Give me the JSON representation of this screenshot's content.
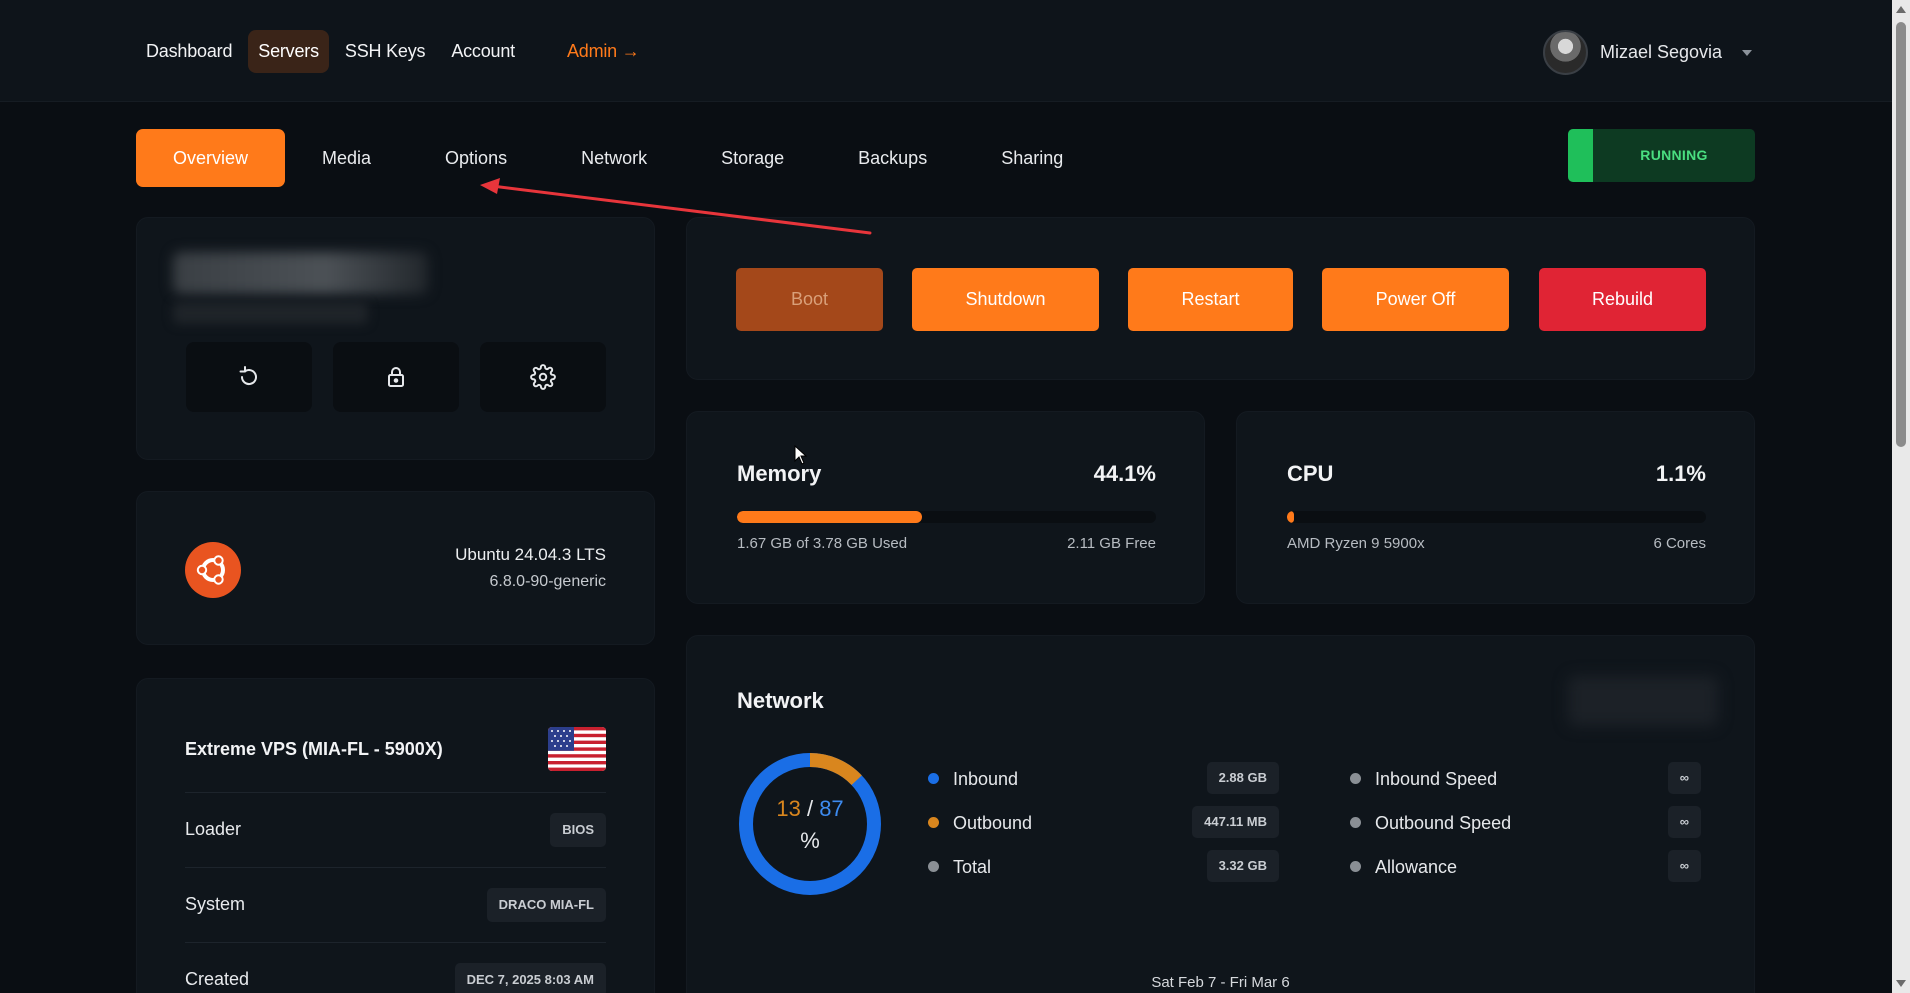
{
  "nav": {
    "dashboard": "Dashboard",
    "servers": "Servers",
    "ssh_keys": "SSH Keys",
    "account": "Account",
    "admin": "Admin →"
  },
  "user": {
    "name": "Mizael Segovia"
  },
  "tabs": [
    "Overview",
    "Media",
    "Options",
    "Network",
    "Storage",
    "Backups",
    "Sharing"
  ],
  "status": {
    "label": "RUNNING",
    "color": "#4ade80"
  },
  "quick_actions": [
    "reinstall-icon",
    "lock-icon",
    "gear-icon"
  ],
  "os": {
    "name": "Ubuntu 24.04.3 LTS",
    "kernel": "6.8.0-90-generic",
    "icon": "ubuntu-icon"
  },
  "plan": {
    "title": "Extreme VPS (MIA-FL - 5900X)",
    "flag_icon": "us-flag-icon",
    "specs": [
      {
        "key": "Loader",
        "value": "BIOS"
      },
      {
        "key": "System",
        "value": "DRACO MIA-FL"
      },
      {
        "key": "Created",
        "value": "DEC 7, 2025 8:03 AM"
      }
    ]
  },
  "power": {
    "boot": "Boot",
    "shutdown": "Shutdown",
    "restart": "Restart",
    "poweroff": "Power Off",
    "rebuild": "Rebuild"
  },
  "memory": {
    "title": "Memory",
    "percent": "44.1%",
    "fraction": 0.441,
    "used": "1.67 GB of 3.78 GB Used",
    "free": "2.11 GB Free"
  },
  "cpu": {
    "title": "CPU",
    "percent": "1.1%",
    "fraction": 0.011,
    "model": "AMD Ryzen 9 5900x",
    "cores": "6 Cores"
  },
  "network": {
    "title": "Network",
    "outbound_pct": "13",
    "separator": "/",
    "inbound_pct": "87",
    "pct_symbol": "%",
    "outbound_fraction": 0.13,
    "stats": [
      {
        "name": "Inbound",
        "value": "2.88 GB",
        "color": "#1a6ee6"
      },
      {
        "name": "Outbound",
        "value": "447.11 MB",
        "color": "#d9861e"
      },
      {
        "name": "Total",
        "value": "3.32 GB",
        "color": "#8a8f95"
      }
    ],
    "limits": [
      {
        "name": "Inbound Speed",
        "value": "∞"
      },
      {
        "name": "Outbound Speed",
        "value": "∞"
      },
      {
        "name": "Allowance",
        "value": "∞"
      }
    ],
    "date_range": "Sat Feb 7 - Fri Mar 6"
  },
  "colors": {
    "accent": "#ff7a1a",
    "danger": "#e02434",
    "inbound": "#1a6ee6",
    "outbound": "#d9861e"
  }
}
